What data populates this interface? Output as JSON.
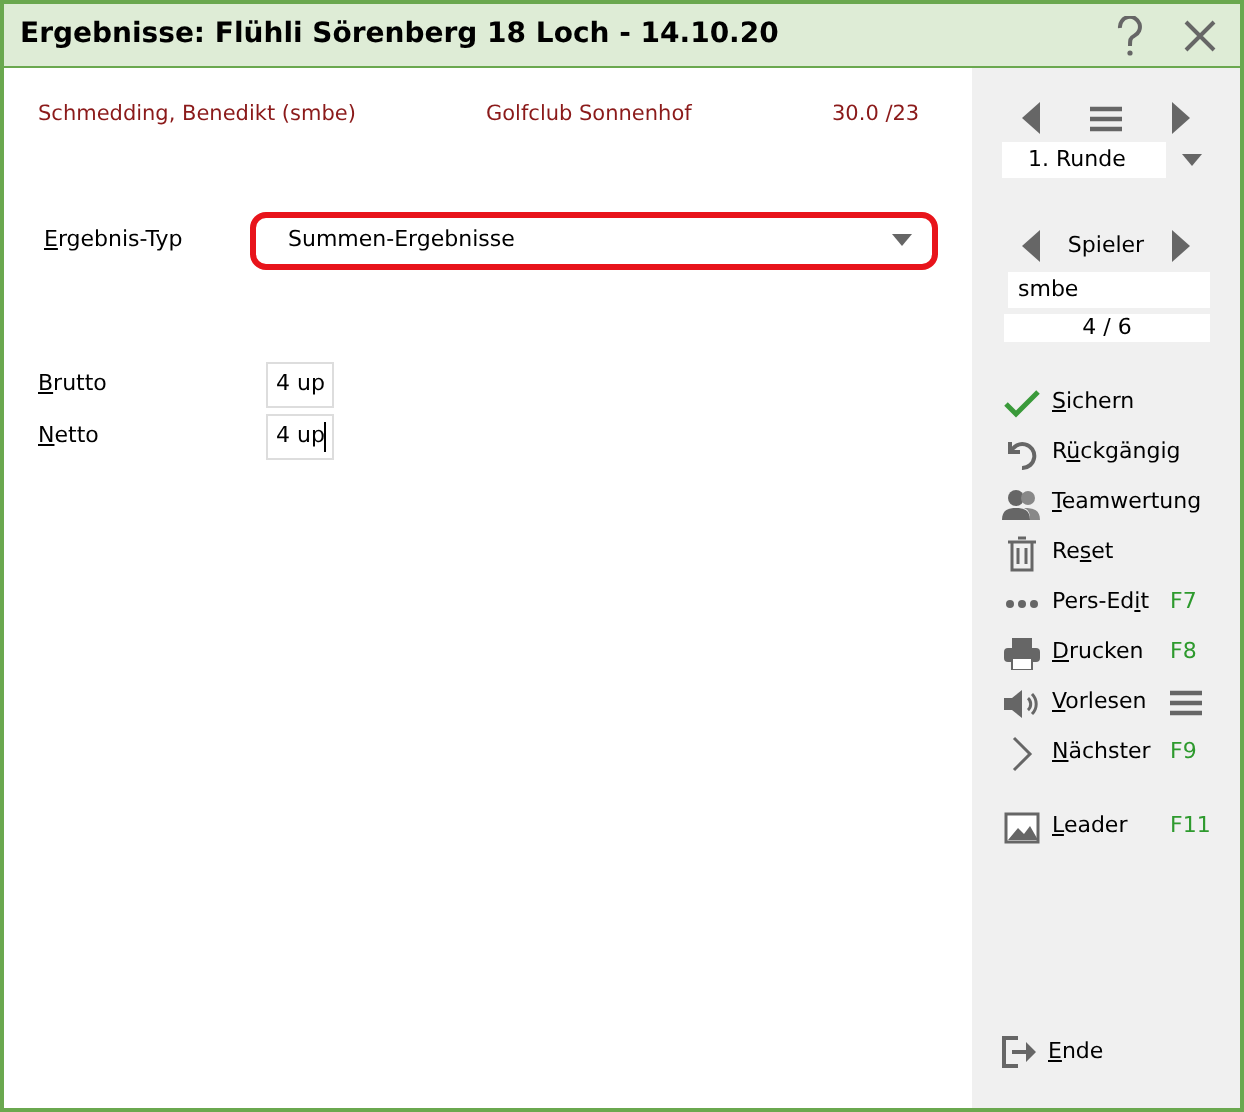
{
  "window": {
    "title": "Ergebnisse: Flühli Sörenberg 18 Loch - 14.10.20"
  },
  "player_info": {
    "name": "Schmedding, Benedikt (smbe)",
    "club": "Golfclub Sonnenhof",
    "handicap": "30.0 /23"
  },
  "result_type": {
    "label": {
      "key": "E",
      "post": "rgebnis-Typ"
    },
    "value": "Summen-Ergebnisse",
    "highlighted": true
  },
  "results": [
    {
      "label": {
        "key": "B",
        "post": "rutto"
      },
      "value": "4 up",
      "focused": false
    },
    {
      "label": {
        "key": "N",
        "post": "etto"
      },
      "value": "4 up",
      "focused": true
    }
  ],
  "sidebar": {
    "round": "1. Runde",
    "player_label": "Spieler",
    "player": "smbe",
    "position": "4 / 6",
    "actions": [
      {
        "label": {
          "key": "S",
          "post": "ichern"
        }
      },
      {
        "label": {
          "pre": "R",
          "key": "ü",
          "post": "ckgängig"
        }
      },
      {
        "label": {
          "key": "T",
          "post": "eamwertung"
        }
      },
      {
        "label": {
          "pre": "Re",
          "key": "s",
          "post": "et"
        }
      },
      {
        "label": {
          "pre": "Pers-Ed",
          "key": "i",
          "post": "t"
        },
        "shortcut": "F7"
      },
      {
        "label": {
          "key": "D",
          "post": "rucken"
        },
        "shortcut": "F8"
      },
      {
        "label": {
          "key": "V",
          "post": "orlesen"
        },
        "menu": true
      },
      {
        "label": {
          "key": "N",
          "post": "ächster"
        },
        "shortcut": "F9"
      },
      {
        "label": {
          "key": "L",
          "post": "eader"
        },
        "shortcut": "F11"
      }
    ],
    "exit": {
      "label": {
        "key": "E",
        "post": "nde"
      }
    }
  }
}
